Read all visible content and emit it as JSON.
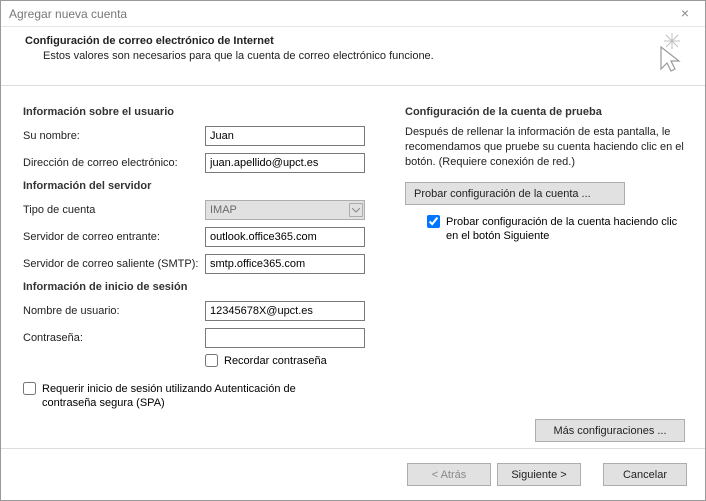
{
  "titlebar": {
    "title": "Agregar nueva cuenta"
  },
  "header": {
    "title": "Configuración de correo electrónico de Internet",
    "subtitle": "Estos valores son necesarios para que la cuenta de correo electrónico funcione."
  },
  "left": {
    "section_user": "Información sobre el usuario",
    "name_label": "Su nombre:",
    "name_value": "Juan",
    "email_label": "Dirección de correo electrónico:",
    "email_value": "juan.apellido@upct.es",
    "section_server": "Información del servidor",
    "acct_type_label": "Tipo de cuenta",
    "acct_type_value": "IMAP",
    "incoming_label": "Servidor de correo entrante:",
    "incoming_value": "outlook.office365.com",
    "outgoing_label": "Servidor de correo saliente (SMTP):",
    "outgoing_value": "smtp.office365.com",
    "section_login": "Información de inicio de sesión",
    "user_label": "Nombre de usuario:",
    "user_value": "12345678X@upct.es",
    "pass_label": "Contraseña:",
    "pass_value": "",
    "remember_label": "Recordar contraseña",
    "spa_label": "Requerir inicio de sesión utilizando Autenticación de contraseña segura (SPA)"
  },
  "right": {
    "section_title": "Configuración de la cuenta de prueba",
    "desc": "Después de rellenar la información de esta pantalla, le recomendamos que pruebe su cuenta haciendo clic en el botón. (Requiere conexión de red.)",
    "test_btn": "Probar configuración de la cuenta ...",
    "test_chk": "Probar configuración de la cuenta haciendo clic en el botón Siguiente",
    "more_btn": "Más configuraciones ..."
  },
  "footer": {
    "back": "< Atrás",
    "next": "Siguiente >",
    "cancel": "Cancelar"
  }
}
